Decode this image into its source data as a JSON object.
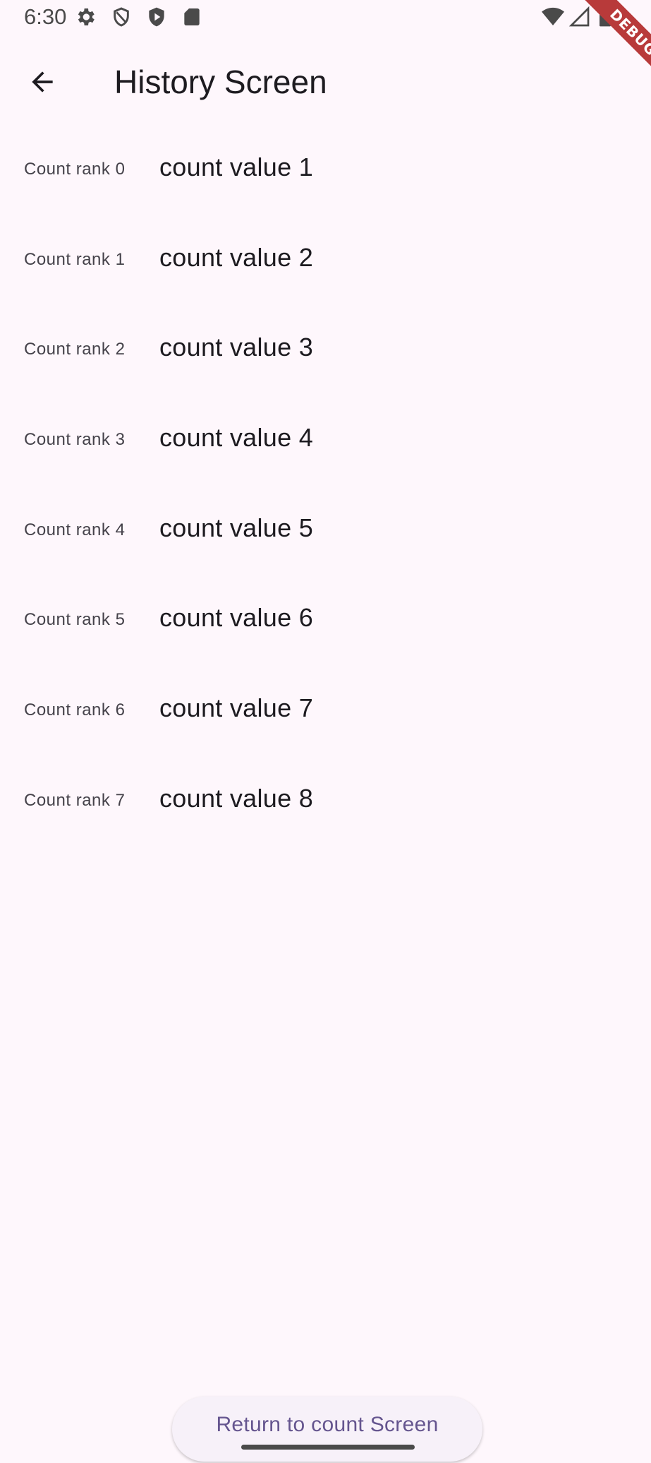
{
  "status_bar": {
    "time": "6:30",
    "left_icons": [
      "gear-icon",
      "shield-outline-icon",
      "shield-play-icon",
      "sd-card-icon"
    ],
    "right_icons": [
      "wifi-icon",
      "cell-signal-icon",
      "battery-icon"
    ]
  },
  "debug_banner": {
    "label": "DEBUG",
    "color": "#b83a3a"
  },
  "app_bar": {
    "back_icon": "arrow-back-icon",
    "title": "History Screen"
  },
  "history": [
    {
      "rank_label": "Count rank 0",
      "value_label": "count value 1"
    },
    {
      "rank_label": "Count rank 1",
      "value_label": "count value 2"
    },
    {
      "rank_label": "Count rank 2",
      "value_label": "count value 3"
    },
    {
      "rank_label": "Count rank 3",
      "value_label": "count value 4"
    },
    {
      "rank_label": "Count rank 4",
      "value_label": "count value 5"
    },
    {
      "rank_label": "Count rank 5",
      "value_label": "count value 6"
    },
    {
      "rank_label": "Count rank 6",
      "value_label": "count value 7"
    },
    {
      "rank_label": "Count rank 7",
      "value_label": "count value 8"
    }
  ],
  "footer": {
    "return_label": "Return to count Screen"
  },
  "colors": {
    "background": "#fef7fc",
    "primary_text": "#1d1b20",
    "secondary_text": "#45424a",
    "button_text": "#65558f",
    "button_bg": "#f7f1f9"
  }
}
